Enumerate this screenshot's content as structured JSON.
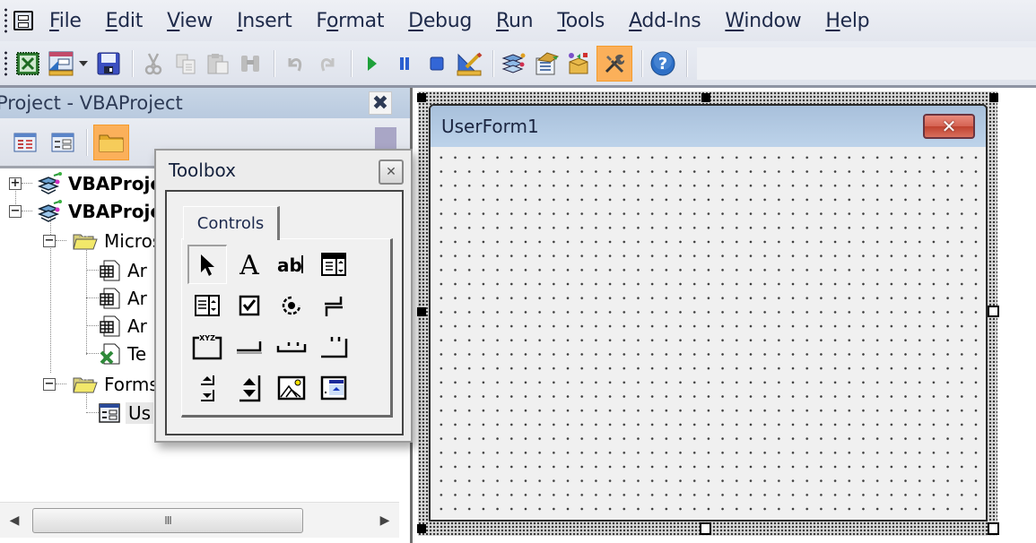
{
  "menubar": {
    "items": [
      {
        "label": "File",
        "accel": "F"
      },
      {
        "label": "Edit",
        "accel": "E"
      },
      {
        "label": "View",
        "accel": "V"
      },
      {
        "label": "Insert",
        "accel": "I"
      },
      {
        "label": "Format",
        "accel": "o"
      },
      {
        "label": "Debug",
        "accel": "D"
      },
      {
        "label": "Run",
        "accel": "R"
      },
      {
        "label": "Tools",
        "accel": "T"
      },
      {
        "label": "Add-Ins",
        "accel": "A"
      },
      {
        "label": "Window",
        "accel": "W"
      },
      {
        "label": "Help",
        "accel": "H"
      }
    ]
  },
  "toolbar": {
    "buttons": [
      {
        "icon": "excel-view-icon"
      },
      {
        "icon": "insert-userform-icon"
      },
      {
        "icon": "dropdown-arrow-icon"
      },
      {
        "icon": "save-icon"
      },
      {
        "icon": "cut-icon",
        "disabled": true
      },
      {
        "icon": "copy-icon",
        "disabled": true
      },
      {
        "icon": "paste-icon",
        "disabled": true
      },
      {
        "icon": "find-icon",
        "disabled": true
      },
      {
        "icon": "undo-icon",
        "disabled": true
      },
      {
        "icon": "redo-icon",
        "disabled": true
      },
      {
        "icon": "run-icon"
      },
      {
        "icon": "break-icon"
      },
      {
        "icon": "reset-icon"
      },
      {
        "icon": "design-mode-icon"
      },
      {
        "icon": "project-explorer-icon"
      },
      {
        "icon": "properties-window-icon"
      },
      {
        "icon": "object-browser-icon"
      },
      {
        "icon": "toolbox-icon",
        "active": true
      },
      {
        "icon": "help-icon"
      }
    ]
  },
  "project": {
    "title": "Project - VBAProject",
    "close_glyph": "✕",
    "toolbar": [
      {
        "icon": "view-code-icon"
      },
      {
        "icon": "view-object-icon"
      },
      {
        "icon": "toggle-folders-icon",
        "active": true
      }
    ],
    "tree": [
      {
        "label": "VBAProje",
        "expander": "+",
        "icon": "vba-project-icon",
        "bold": true
      },
      {
        "label": "VBAProje",
        "expander": "−",
        "icon": "vba-project-icon",
        "bold": true
      },
      {
        "label": "Micros",
        "expander": "−",
        "icon": "folder-icon"
      },
      {
        "label": "Ar",
        "icon": "worksheet-icon"
      },
      {
        "label": "Ar",
        "icon": "worksheet-icon"
      },
      {
        "label": "Ar",
        "icon": "worksheet-icon"
      },
      {
        "label": "Te",
        "icon": "workbook-icon"
      },
      {
        "label": "Forms",
        "expander": "−",
        "icon": "folder-icon"
      },
      {
        "label": "Us",
        "icon": "userform-icon",
        "selected": true
      }
    ],
    "scrollbar": {
      "left": "◀",
      "right": "▶",
      "grip": "III"
    }
  },
  "toolbox": {
    "title": "Toolbox",
    "close_glyph": "✕",
    "tab": "Controls",
    "controls": [
      {
        "name": "select-objects",
        "icon": "pointer-icon",
        "selected": true
      },
      {
        "name": "label",
        "icon": "label-icon"
      },
      {
        "name": "textbox",
        "icon": "textbox-icon"
      },
      {
        "name": "combobox",
        "icon": "combobox-icon"
      },
      {
        "name": "listbox",
        "icon": "listbox-icon"
      },
      {
        "name": "checkbox",
        "icon": "checkbox-icon"
      },
      {
        "name": "optionbutton",
        "icon": "optionbutton-icon"
      },
      {
        "name": "togglebutton",
        "icon": "togglebutton-icon"
      },
      {
        "name": "frame",
        "icon": "frame-icon"
      },
      {
        "name": "commandbutton",
        "icon": "commandbutton-icon"
      },
      {
        "name": "tabstrip",
        "icon": "tabstrip-icon"
      },
      {
        "name": "multipage",
        "icon": "multipage-icon"
      },
      {
        "name": "scrollbar",
        "icon": "scrollbar-icon"
      },
      {
        "name": "spinbutton",
        "icon": "spinbutton-icon"
      },
      {
        "name": "image",
        "icon": "image-icon"
      },
      {
        "name": "refedit",
        "icon": "refedit-icon"
      }
    ],
    "frame_label": "XYZ"
  },
  "designer": {
    "form_title": "UserForm1",
    "close_glyph": "✕"
  }
}
